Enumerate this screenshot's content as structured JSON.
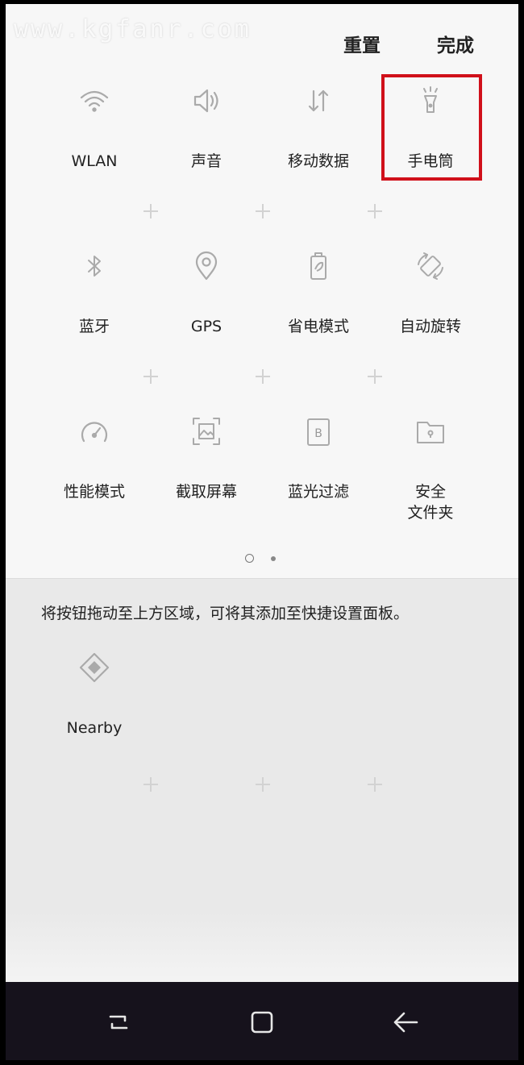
{
  "watermark": "www.kgfanr.com",
  "header": {
    "reset_label": "重置",
    "done_label": "完成"
  },
  "active_tiles": [
    {
      "label": "WLAN",
      "icon": "wifi-icon"
    },
    {
      "label": "声音",
      "icon": "speaker-icon"
    },
    {
      "label": "移动数据",
      "icon": "mobile-data-icon"
    },
    {
      "label": "手电筒",
      "icon": "flashlight-icon"
    },
    {
      "label": "蓝牙",
      "icon": "bluetooth-icon"
    },
    {
      "label": "GPS",
      "icon": "location-pin-icon"
    },
    {
      "label": "省电模式",
      "icon": "battery-saver-icon"
    },
    {
      "label": "自动旋转",
      "icon": "auto-rotate-icon"
    },
    {
      "label": "性能模式",
      "icon": "speedometer-icon"
    },
    {
      "label": "截取屏幕",
      "icon": "screenshot-icon"
    },
    {
      "label": "蓝光过滤",
      "icon": "blue-light-filter-icon"
    },
    {
      "label": "安全\n文件夹",
      "icon": "secure-folder-icon"
    }
  ],
  "pagination": {
    "pages": 2,
    "current": 1
  },
  "available": {
    "hint": "将按钮拖动至上方区域，可将其添加至快捷设置面板。",
    "tiles": [
      {
        "label": "Nearby",
        "icon": "nearby-icon"
      }
    ]
  },
  "highlight_color": "#d0101a",
  "nav": {
    "recent": "recent-apps-icon",
    "home": "home-icon",
    "back": "back-icon"
  }
}
